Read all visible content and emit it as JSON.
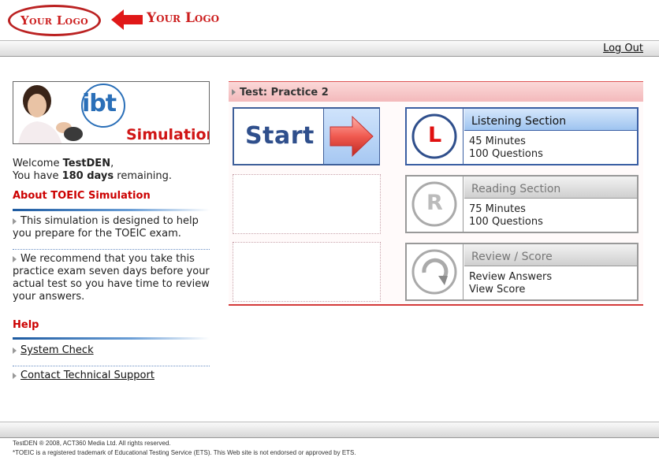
{
  "header": {
    "logo_text": "Your Logo",
    "logo_text_2": "Your Logo",
    "logout": "Log Out"
  },
  "banner": {
    "brand": "ibt",
    "caption": "Simulation"
  },
  "welcome": {
    "prefix": "Welcome ",
    "user": "TestDEN",
    "suffix": ",",
    "days_prefix": "You have ",
    "days": "180 days",
    "days_suffix": " remaining."
  },
  "about": {
    "heading": "About TOEIC Simulation",
    "p1": "This simulation is designed to help you prepare for the TOEIC exam.",
    "p2": "We recommend that you take this practice exam seven days before your actual test so you have time to review your answers."
  },
  "help": {
    "heading": "Help",
    "links": [
      "System Check",
      "Contact Technical Support"
    ]
  },
  "test": {
    "title": "Test: Practice 2",
    "start_label": "Start"
  },
  "sections": [
    {
      "title": "Listening Section",
      "icon_letter": "L",
      "lines": [
        "45 Minutes",
        "100 Questions"
      ]
    },
    {
      "title": "Reading Section",
      "icon_letter": "R",
      "lines": [
        "75 Minutes",
        "100 Questions"
      ]
    },
    {
      "title": "Review / Score",
      "icon_letter": "",
      "lines": [
        "Review Answers",
        "View Score"
      ]
    }
  ],
  "footer": {
    "line1": "TestDEN ® 2008, ACT360 Media Ltd. All rights reserved.",
    "line2": "*TOEIC is a registered trademark of Educational Testing Service (ETS). This Web site is not endorsed or approved by ETS."
  },
  "colors": {
    "brand_red": "#cc1f1f",
    "accent_blue": "#3a5ea3",
    "header_pink": "#f3b9bb"
  }
}
